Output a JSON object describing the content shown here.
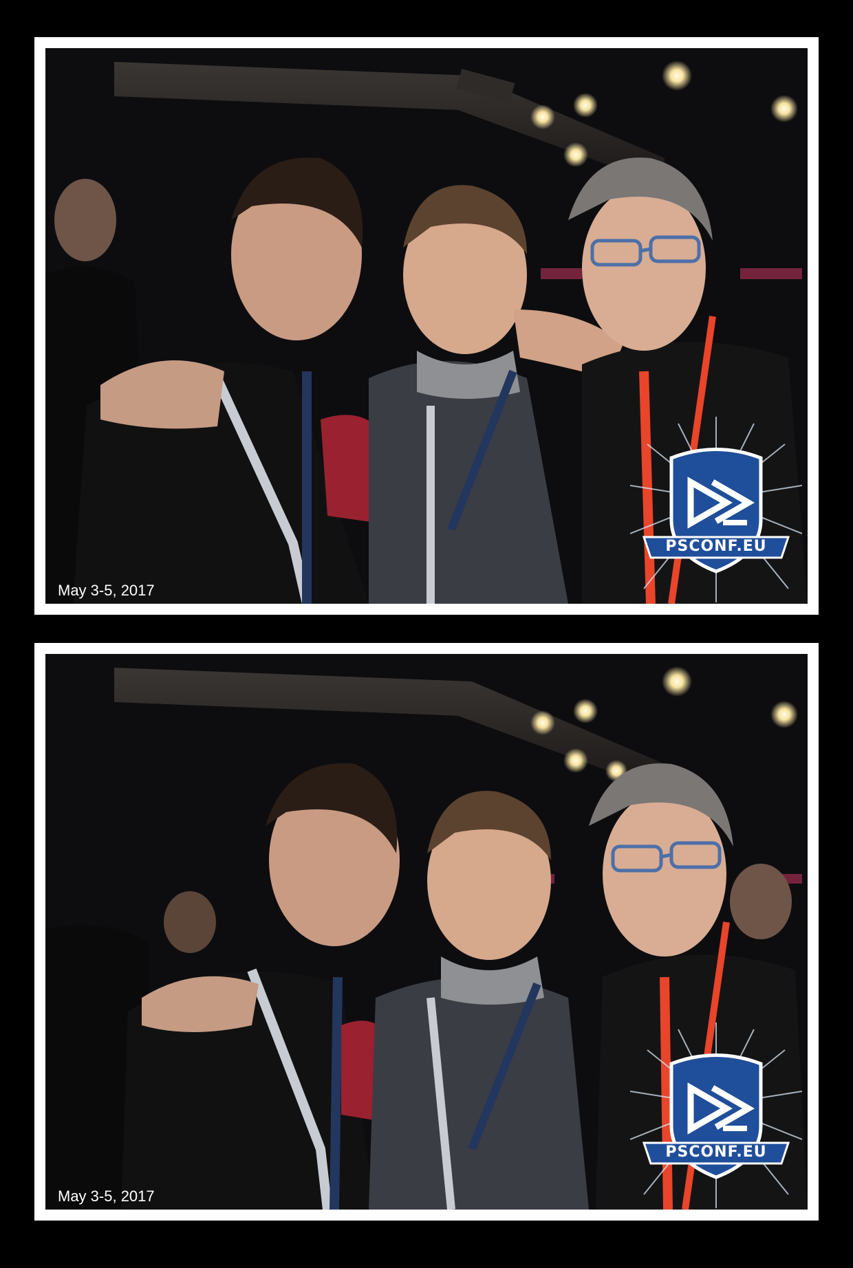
{
  "photos": [
    {
      "caption": "May 3-5, 2017",
      "badge": "PSCONF.EU"
    },
    {
      "caption": "May 3-5, 2017",
      "badge": "PSCONF.EU"
    }
  ],
  "colors": {
    "frame": "#ffffff",
    "background": "#000000",
    "badge_blue": "#1f4e9a",
    "lanyard_orange": "#e8452a"
  }
}
